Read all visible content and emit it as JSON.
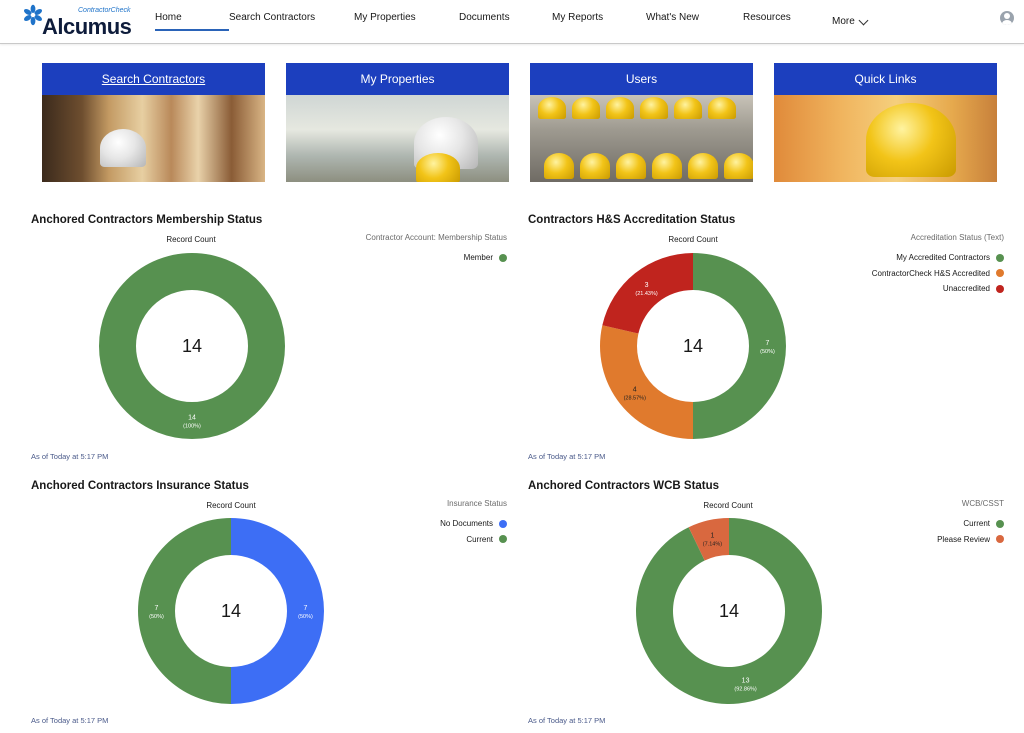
{
  "brand": {
    "small": "ContractorCheck",
    "big": "Alcumus"
  },
  "nav": {
    "items": [
      {
        "label": "Home",
        "active": true
      },
      {
        "label": "Search Contractors"
      },
      {
        "label": "My Properties"
      },
      {
        "label": "Documents"
      },
      {
        "label": "My Reports"
      },
      {
        "label": "What's New"
      },
      {
        "label": "Resources"
      }
    ],
    "more_label": "More"
  },
  "tiles": [
    {
      "label": "Search Contractors"
    },
    {
      "label": "My Properties"
    },
    {
      "label": "Users"
    },
    {
      "label": "Quick Links"
    }
  ],
  "chart_data": [
    {
      "type": "pie",
      "title": "Anchored Contractors Membership Status",
      "measure_label": "Record Count",
      "total": "14",
      "legend_title": "Contractor Account: Membership Status",
      "footer": "As of Today at 5:17 PM",
      "slices": [
        {
          "name": "Member",
          "value": 14,
          "value_label": "14",
          "pct_label": "(100%)",
          "color": "#579150"
        }
      ]
    },
    {
      "type": "pie",
      "title": "Contractors H&S Accreditation Status",
      "measure_label": "Record Count",
      "total": "14",
      "legend_title": "Accreditation Status (Text)",
      "footer": "As of Today at 5:17 PM",
      "slices": [
        {
          "name": "My Accredited Contractors",
          "value": 7,
          "value_label": "7",
          "pct_label": "(50%)",
          "color": "#579150"
        },
        {
          "name": "ContractorCheck H&S Accredited",
          "value": 4,
          "value_label": "4",
          "pct_label": "(28.57%)",
          "color": "#e07a2d"
        },
        {
          "name": "Unaccredited",
          "value": 3,
          "value_label": "3",
          "pct_label": "(21.43%)",
          "color": "#c0241e"
        }
      ]
    },
    {
      "type": "pie",
      "title": "Anchored Contractors Insurance Status",
      "measure_label": "Record Count",
      "total": "14",
      "legend_title": "Insurance Status",
      "footer": "As of Today at 5:17 PM",
      "slices": [
        {
          "name": "No Documents",
          "value": 7,
          "value_label": "7",
          "pct_label": "(50%)",
          "color": "#3d6ef5"
        },
        {
          "name": "Current",
          "value": 7,
          "value_label": "7",
          "pct_label": "(50%)",
          "color": "#579150"
        }
      ]
    },
    {
      "type": "pie",
      "title": "Anchored Contractors WCB Status",
      "measure_label": "Record Count",
      "total": "14",
      "legend_title": "WCB/CSST",
      "footer": "As of Today at 5:17 PM",
      "slices": [
        {
          "name": "Current",
          "value": 13,
          "value_label": "13",
          "pct_label": "(92.86%)",
          "color": "#579150"
        },
        {
          "name": "Please Review",
          "value": 1,
          "value_label": "1",
          "pct_label": "(7.14%)",
          "color": "#d9683f"
        }
      ]
    }
  ]
}
